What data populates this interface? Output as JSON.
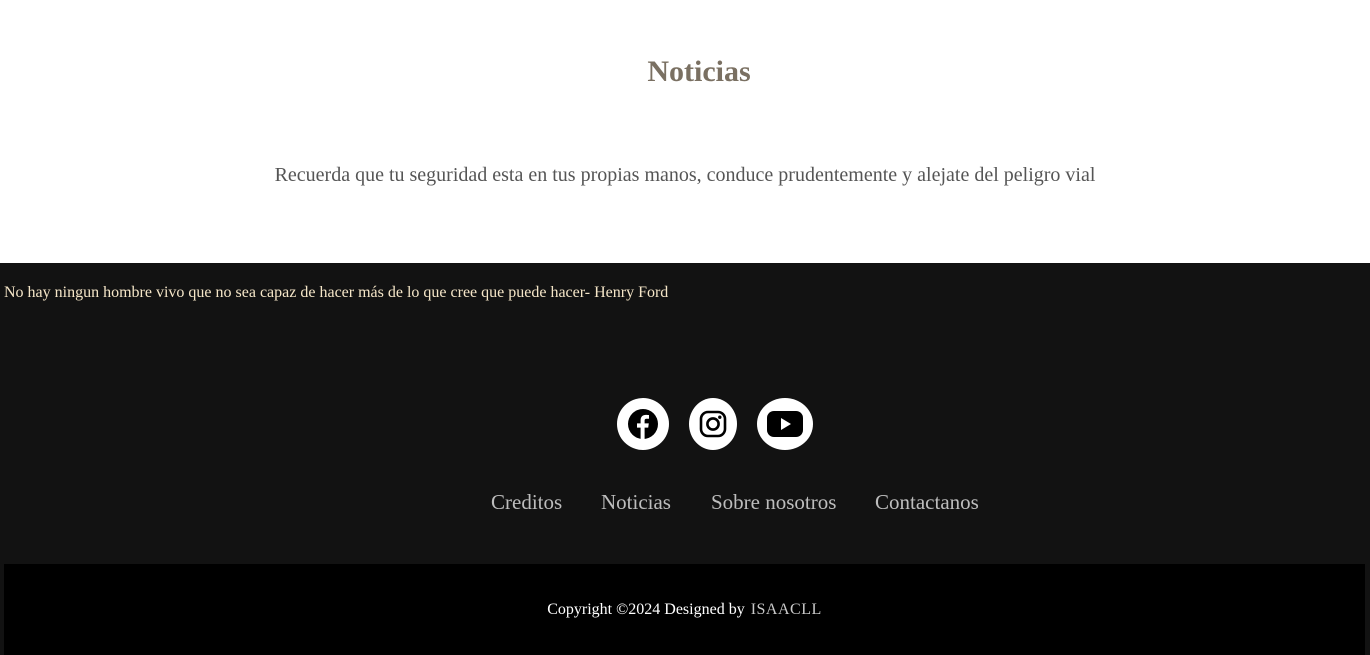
{
  "header": {
    "title": "Noticias",
    "message": "Recuerda que tu seguridad esta en tus propias manos, conduce prudentemente y alejate del peligro vial"
  },
  "footer": {
    "quote": "No hay ningun hombre vivo que no sea capaz de hacer más de lo que cree que puede hacer- Henry Ford",
    "social": [
      {
        "name": "facebook-icon"
      },
      {
        "name": "instagram-icon"
      },
      {
        "name": "youtube-icon"
      }
    ],
    "nav": [
      {
        "label": "Creditos"
      },
      {
        "label": "Noticias"
      },
      {
        "label": "Sobre nosotros"
      },
      {
        "label": "Contactanos"
      }
    ],
    "copyright_prefix": "Copyright ©2024 Designed by",
    "copyright_author": "ISAACLL"
  },
  "colors": {
    "title": "#7a7062",
    "footer_bg": "#121212",
    "quote": "#f5e6c8",
    "copyright_bg": "#000000"
  }
}
